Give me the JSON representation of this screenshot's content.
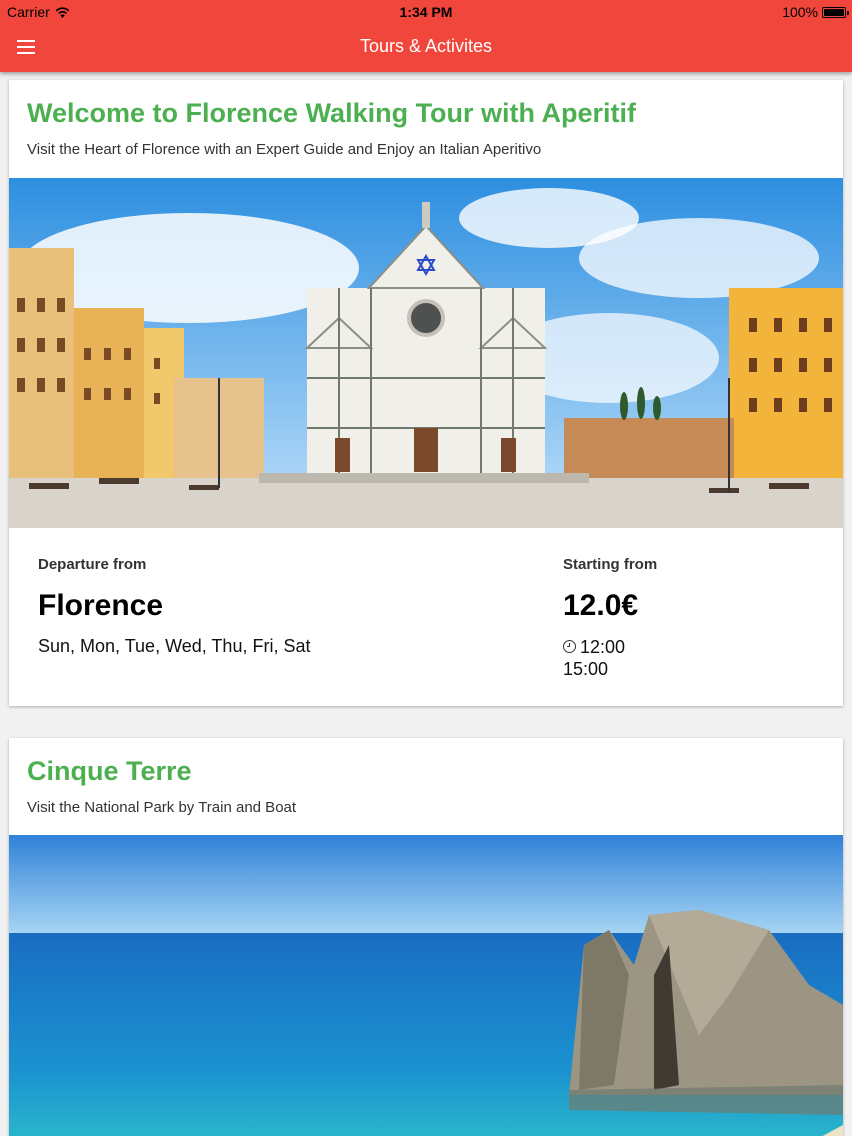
{
  "status_bar": {
    "carrier": "Carrier",
    "time": "1:34 PM",
    "battery": "100%"
  },
  "app_bar": {
    "title": "Tours & Activites",
    "menu_icon": "hamburger-menu-icon"
  },
  "colors": {
    "app_bar": "#f0463b",
    "card_title": "#4caf50"
  },
  "tours": [
    {
      "title": "Welcome to Florence Walking Tour with Aperitif",
      "subtitle": "Visit the Heart of Florence with an Expert Guide and Enjoy an Italian Aperitivo",
      "image": "florence-santa-croce-photo",
      "departure_label": "Departure from",
      "departure": "Florence",
      "days": "Sun, Mon, Tue, Wed, Thu, Fri, Sat",
      "price_label": "Starting from",
      "price": "12.0€",
      "times": [
        "12:00",
        "15:00"
      ]
    },
    {
      "title": "Cinque Terre",
      "subtitle": "Visit the National Park by Train and Boat",
      "image": "cinque-terre-sea-rocks-photo"
    }
  ]
}
